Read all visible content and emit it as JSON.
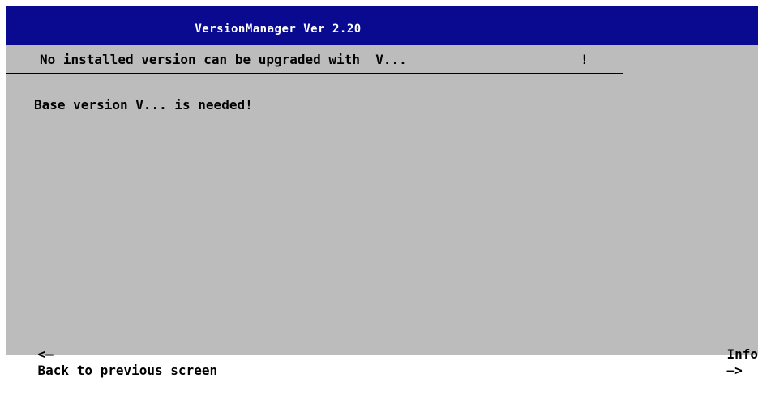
{
  "window": {
    "title": "VersionManager Ver 2.20"
  },
  "header": {
    "text": "No installed version can be upgraded with  V...",
    "mark": "!"
  },
  "main": {
    "message": "Base version V... is needed!"
  },
  "softkeys": {
    "left": {
      "arrow": "<—",
      "label": "Back to previous screen"
    },
    "right": {
      "label": "Info",
      "arrow": "—>"
    }
  },
  "colors": {
    "title_bar": "#0a0a90",
    "background": "#bcbcbc",
    "text": "#000000"
  },
  "icons": {
    "left_arrow": "arrow-left-icon",
    "right_arrow": "arrow-right-icon"
  }
}
